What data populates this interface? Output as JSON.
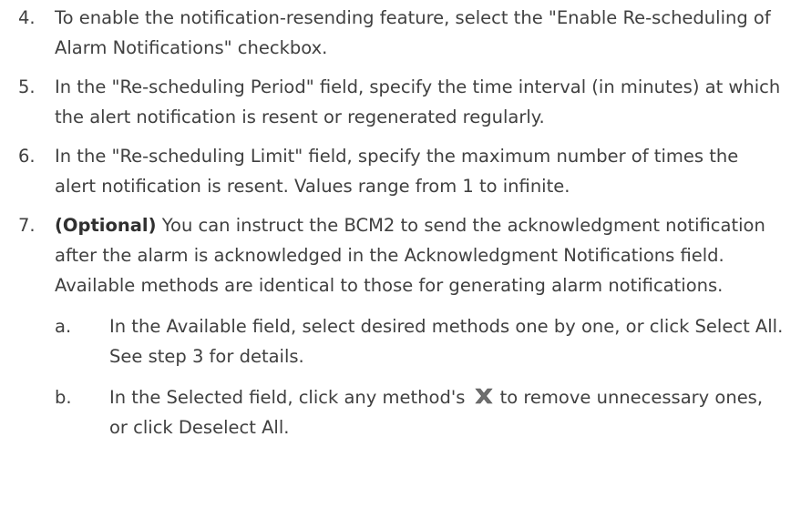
{
  "steps": [
    {
      "num": "4.",
      "text": "To enable the notification-resending feature, select the \"Enable Re-scheduling of Alarm Notifications\" checkbox."
    },
    {
      "num": "5.",
      "text": "In the \"Re-scheduling Period\" field, specify the time interval (in minutes) at which the alert notification is resent or regenerated regularly."
    },
    {
      "num": "6.",
      "text": "In the \"Re-scheduling Limit\" field, specify the maximum number of times the alert notification is resent. Values range from 1 to infinite."
    },
    {
      "num": "7.",
      "optional_label": "(Optional)",
      "text": " You can instruct the BCM2 to send the acknowledgment notification after the alarm is acknowledged in the Acknowledgment Notifications field. Available methods are identical to those for generating alarm notifications.",
      "substeps": [
        {
          "letter": "a.",
          "text": "In the Available field, select desired methods one by one, or click Select All. See step 3 for details."
        },
        {
          "letter": "b.",
          "text_before": "In the Selected field, click any method's",
          "icon": "remove-x-icon",
          "text_after": "to remove unnecessary ones, or click Deselect All."
        }
      ]
    }
  ],
  "colors": {
    "text": "#404040",
    "icon": "#6e6e6e"
  }
}
